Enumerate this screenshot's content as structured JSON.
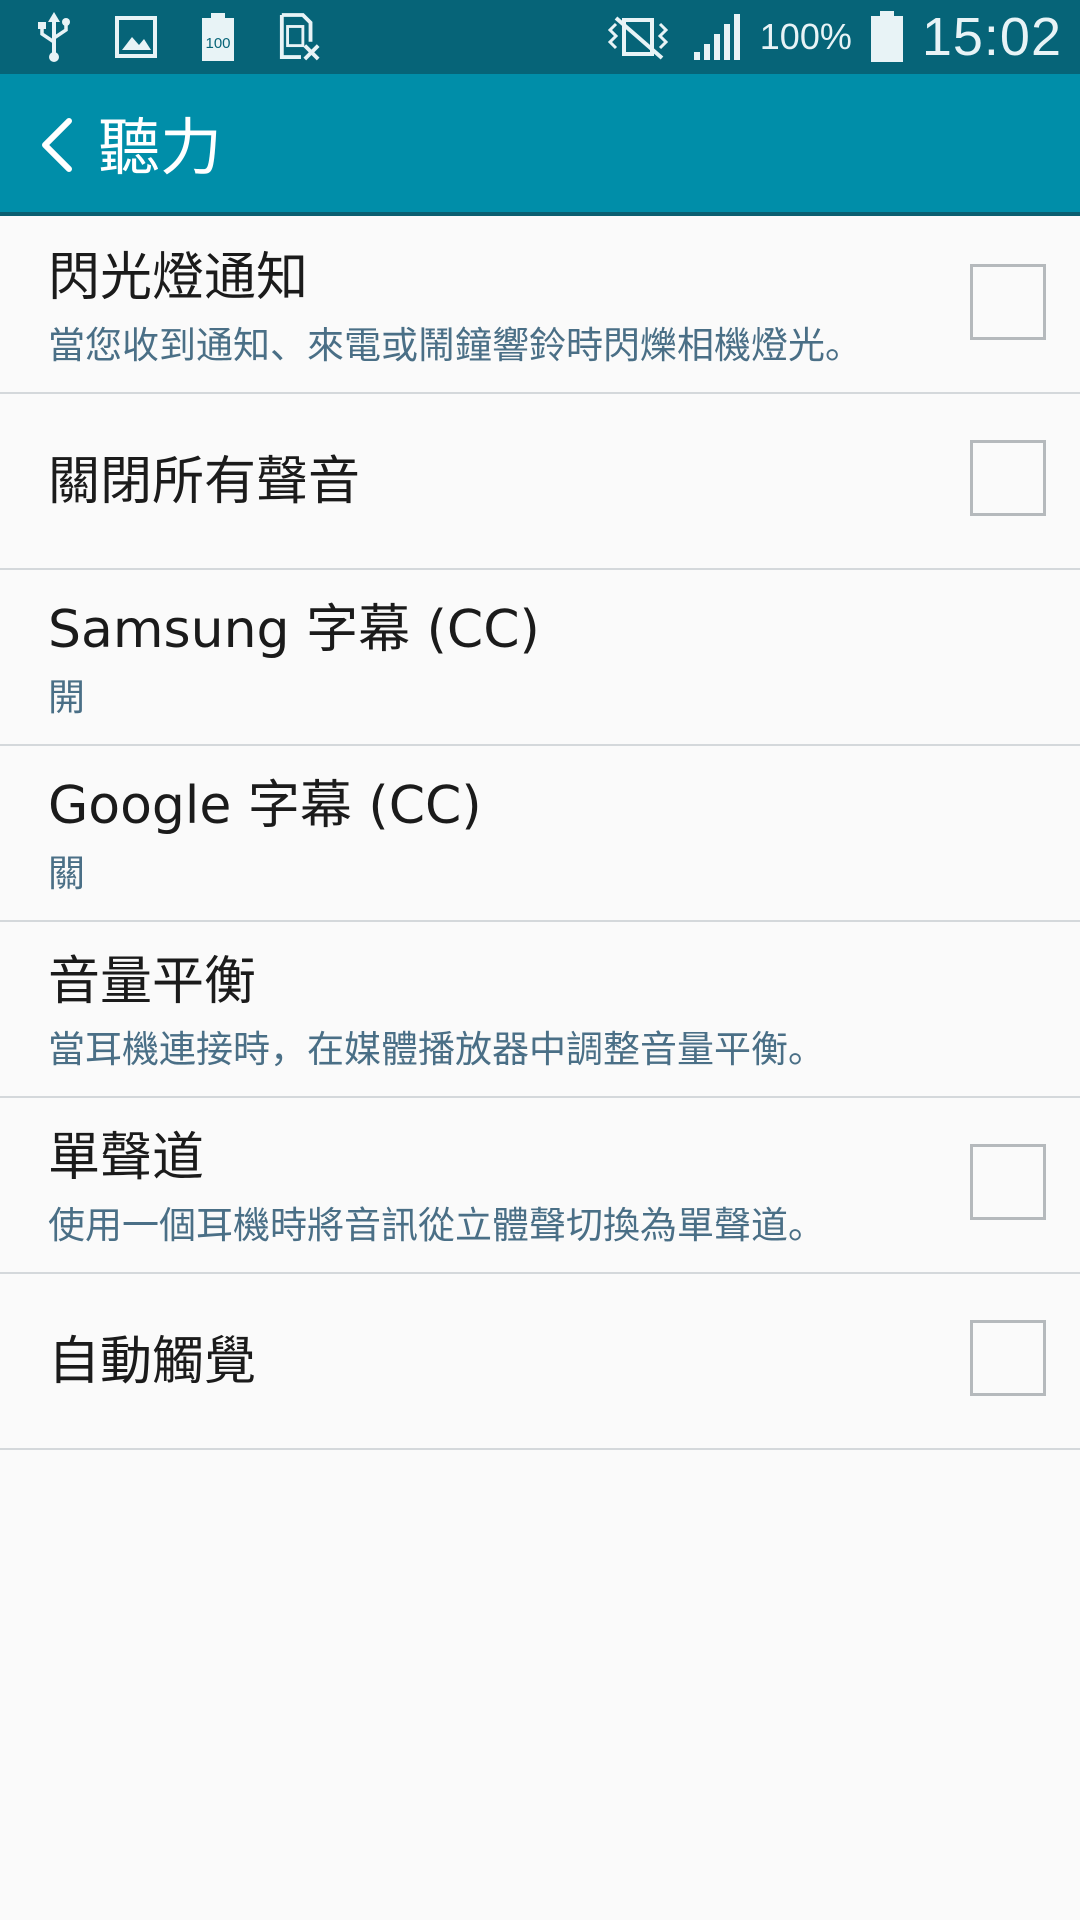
{
  "status_bar": {
    "icons_left": [
      "usb-icon",
      "image-icon",
      "battery-100-icon",
      "sim-missing-icon"
    ],
    "icons_right": [
      "vibrate-icon",
      "signal-icon"
    ],
    "battery_percent": "100%",
    "time": "15:02"
  },
  "app_bar": {
    "title": "聽力",
    "back_icon": "chevron-left-icon"
  },
  "settings": [
    {
      "title": "閃光燈通知",
      "subtitle": "當您收到通知、來電或鬧鐘響鈴時閃爍相機燈光。",
      "checkbox": true,
      "checked": false
    },
    {
      "title": "關閉所有聲音",
      "checkbox": true,
      "checked": false
    },
    {
      "title": "Samsung 字幕 (CC)",
      "subtitle": "開",
      "checkbox": false
    },
    {
      "title": "Google 字幕 (CC)",
      "subtitle": "關",
      "checkbox": false
    },
    {
      "title": "音量平衡",
      "subtitle": "當耳機連接時，在媒體播放器中調整音量平衡。",
      "checkbox": false
    },
    {
      "title": "單聲道",
      "subtitle": "使用一個耳機時將音訊從立體聲切換為單聲道。",
      "checkbox": true,
      "checked": false
    },
    {
      "title": "自動觸覺",
      "checkbox": true,
      "checked": false
    }
  ],
  "colors": {
    "status_bar_bg": "#066478",
    "app_bar_bg": "#008ea9",
    "subtitle_text": "#4a6f86",
    "background": "#fafafa"
  }
}
